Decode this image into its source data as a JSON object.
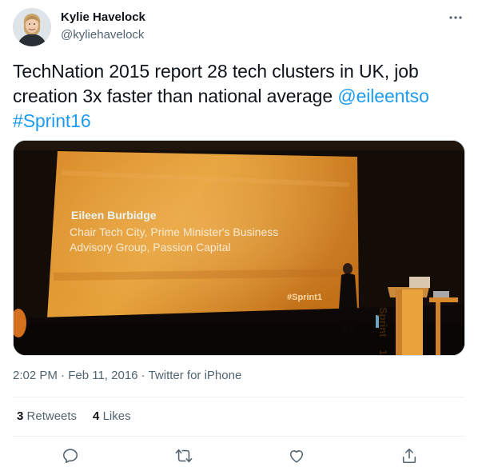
{
  "author": {
    "name": "Kylie Havelock",
    "handle": "@kyliehavelock"
  },
  "tweet": {
    "text_plain": "TechNation 2015 report 28 tech clusters in UK, job creation 3x faster than national average ",
    "mention": "@eileentso",
    "hashtag": "#Sprint16"
  },
  "media": {
    "slide_name": "Eileen Burbidge",
    "slide_line1": "Chair Tech City, Prime Minister's Business",
    "slide_line2": "Advisory Group, Passion Capital",
    "slide_hashtag": "#Sprint1",
    "lectern_text": "Sprint",
    "lectern_number": "16"
  },
  "meta": {
    "time": "2:02 PM",
    "separator": " · ",
    "date": "Feb 11, 2016",
    "source": "Twitter for iPhone"
  },
  "stats": {
    "retweets_count": "3",
    "retweets_label": "Retweets",
    "likes_count": "4",
    "likes_label": "Likes"
  },
  "icons": {
    "more": "more-horizontal-icon",
    "reply": "reply-icon",
    "retweet": "retweet-icon",
    "like": "like-icon",
    "share": "share-icon"
  },
  "colors": {
    "link": "#1d9bf0",
    "secondary_text": "#536471",
    "primary_text": "#0f1419",
    "divider": "#eff3f4"
  }
}
